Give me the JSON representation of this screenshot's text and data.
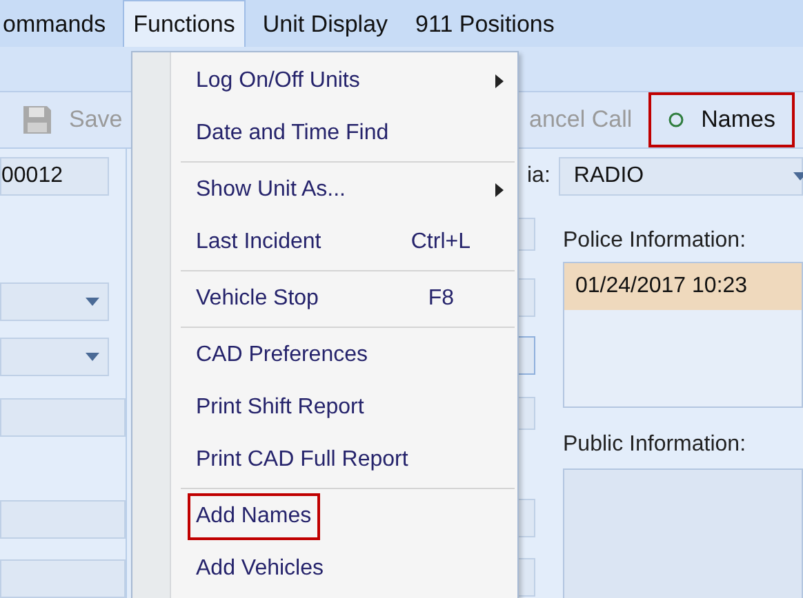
{
  "menubar": [
    {
      "label": "ommands",
      "selected": false
    },
    {
      "label": "Functions",
      "selected": true
    },
    {
      "label": "Unit Display",
      "selected": false
    },
    {
      "label": "911 Positions",
      "selected": false
    }
  ],
  "toolbar": [
    {
      "label": "Save",
      "kind": "save",
      "disabled": true,
      "highlighted": false
    },
    {
      "label": "ancel Call",
      "kind": "text",
      "disabled": true,
      "highlighted": false
    },
    {
      "label": "Names",
      "kind": "names",
      "disabled": false,
      "highlighted": true
    }
  ],
  "left_panel": {
    "number_field": "00012"
  },
  "media": {
    "label": "ia:",
    "value": "RADIO"
  },
  "police_information": {
    "label": "Police Information:",
    "entries": [
      "01/24/2017 10:23"
    ]
  },
  "public_information": {
    "label": "Public  Information:"
  },
  "menu": {
    "items": [
      {
        "kind": "item",
        "label": "Log On/Off Units",
        "submenu": true,
        "highlighted": false
      },
      {
        "kind": "item",
        "label": "Date and Time Find",
        "submenu": false,
        "highlighted": false
      },
      {
        "kind": "separator"
      },
      {
        "kind": "item",
        "label": "Show Unit As...",
        "submenu": true,
        "highlighted": false
      },
      {
        "kind": "item",
        "label": "Last Incident",
        "shortcut": "Ctrl+L",
        "submenu": false,
        "highlighted": false
      },
      {
        "kind": "separator"
      },
      {
        "kind": "item",
        "label": "Vehicle Stop",
        "shortcut": "F8",
        "submenu": false,
        "highlighted": false
      },
      {
        "kind": "separator"
      },
      {
        "kind": "item",
        "label": "CAD Preferences",
        "submenu": false,
        "highlighted": false
      },
      {
        "kind": "item",
        "label": "Print Shift Report",
        "submenu": false,
        "highlighted": false
      },
      {
        "kind": "item",
        "label": "Print CAD Full Report",
        "submenu": false,
        "highlighted": false
      },
      {
        "kind": "separator"
      },
      {
        "kind": "item",
        "label": "Add Names",
        "submenu": false,
        "highlighted": true
      },
      {
        "kind": "item",
        "label": "Add Vehicles",
        "submenu": false,
        "highlighted": false
      }
    ]
  }
}
